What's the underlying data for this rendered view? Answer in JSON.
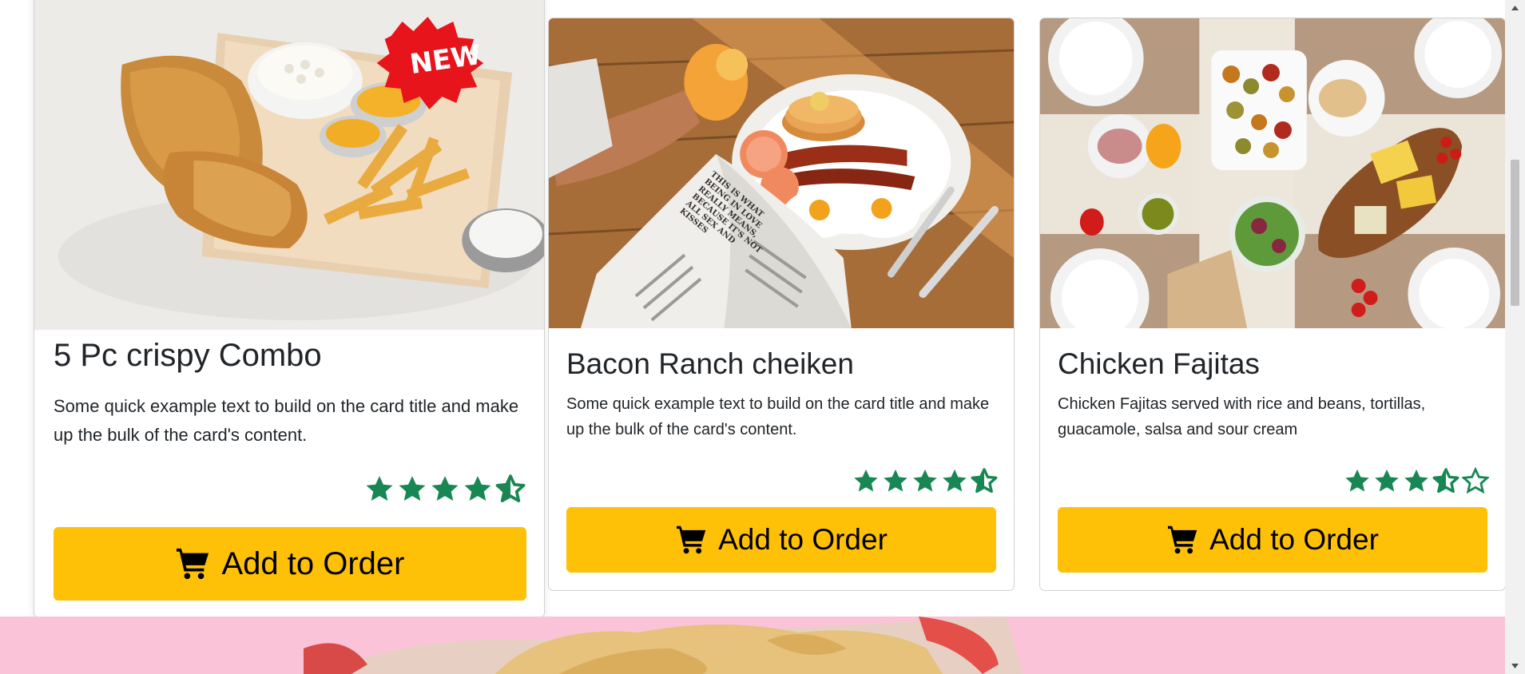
{
  "cards": [
    {
      "title": "5 Pc crispy Combo",
      "text": "Some quick example text to build on the card title and make up the bulk of the card's content.",
      "badge": "NEW",
      "rating": 4.5,
      "button_label": "Add to Order"
    },
    {
      "title": "Bacon Ranch cheiken",
      "text": "Some quick example text to build on the card title and make up the bulk of the card's content.",
      "rating": 4.5,
      "button_label": "Add to Order",
      "newspaper_text": "THIS IS WHAT BEING IN LOVE REALLY MEANS, BECAUSE IT'S NOT ALL SEX AND KISSES"
    },
    {
      "title": "Chicken Fajitas",
      "text": "Chicken Fajitas served with rice and beans, tortillas, guacamole, salsa and sour cream",
      "rating": 3.5,
      "button_label": "Add to Order"
    }
  ],
  "colors": {
    "star": "#198754",
    "button": "#ffc107",
    "banner": "#fbc3d8",
    "badge": "#e8141c"
  },
  "icons": {
    "cart": "cart-icon",
    "star_full": "star-filled-icon",
    "star_half": "star-half-icon"
  }
}
